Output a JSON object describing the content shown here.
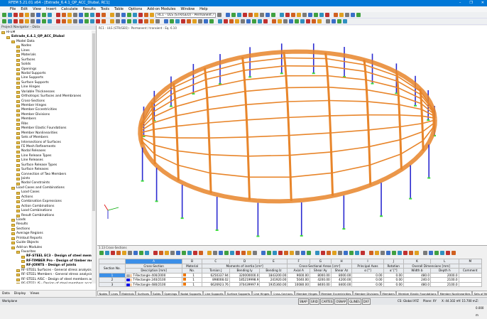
{
  "window": {
    "title": "RFEM 5.21.01 x64 - [Estrade_6.4.1_QP_ACC_Dlubal, RC1]",
    "controls": [
      "–",
      "❐",
      "✕"
    ]
  },
  "menu": [
    "File",
    "Edit",
    "View",
    "Insert",
    "Calculate",
    "Results",
    "Tools",
    "Table",
    "Options",
    "Add-on Modules",
    "Window",
    "Help"
  ],
  "toolbar": {
    "load_combo": "RC1 - ULS (STR/GEO) - Permanent / tran"
  },
  "navigator": {
    "title": "Project Navigator - Data",
    "tabs": [
      "Data",
      "Display",
      "Views"
    ],
    "items": [
      {
        "t": "RFEM",
        "l": 0
      },
      {
        "t": "Estrade_6.4.1_QP_ACC_Dlubal",
        "l": 1,
        "b": true
      },
      {
        "t": "Model Data",
        "l": 2
      },
      {
        "t": "Nodes",
        "l": 3
      },
      {
        "t": "Lines",
        "l": 3
      },
      {
        "t": "Materials",
        "l": 3
      },
      {
        "t": "Surfaces",
        "l": 3
      },
      {
        "t": "Solids",
        "l": 3
      },
      {
        "t": "Openings",
        "l": 3
      },
      {
        "t": "Nodal Supports",
        "l": 3
      },
      {
        "t": "Line Supports",
        "l": 3
      },
      {
        "t": "Surface Supports",
        "l": 3
      },
      {
        "t": "Line Hinges",
        "l": 3
      },
      {
        "t": "Variable Thicknesses",
        "l": 3
      },
      {
        "t": "Orthotropic Surfaces and Membranes",
        "l": 3
      },
      {
        "t": "Cross-Sections",
        "l": 3
      },
      {
        "t": "Member Hinges",
        "l": 3
      },
      {
        "t": "Member Eccentricities",
        "l": 3
      },
      {
        "t": "Member Divisions",
        "l": 3
      },
      {
        "t": "Members",
        "l": 3
      },
      {
        "t": "Ribs",
        "l": 3
      },
      {
        "t": "Member Elastic Foundations",
        "l": 3
      },
      {
        "t": "Member Nonlinearities",
        "l": 3
      },
      {
        "t": "Sets of Members",
        "l": 3
      },
      {
        "t": "Intersections of Surfaces",
        "l": 3
      },
      {
        "t": "FE Mesh Refinements",
        "l": 3
      },
      {
        "t": "Nodal Releases",
        "l": 3
      },
      {
        "t": "Line Release Types",
        "l": 3
      },
      {
        "t": "Line Releases",
        "l": 3
      },
      {
        "t": "Surface Release Types",
        "l": 3
      },
      {
        "t": "Surface Releases",
        "l": 3
      },
      {
        "t": "Connection of Two Members",
        "l": 3
      },
      {
        "t": "Joints",
        "l": 3
      },
      {
        "t": "Nodal Constraints",
        "l": 3
      },
      {
        "t": "Load Cases and Combinations",
        "l": 2
      },
      {
        "t": "Load Cases",
        "l": 3
      },
      {
        "t": "Actions",
        "l": 3
      },
      {
        "t": "Combination Expressions",
        "l": 3
      },
      {
        "t": "Action Combinations",
        "l": 3
      },
      {
        "t": "Load Combinations",
        "l": 3
      },
      {
        "t": "Result Combinations",
        "l": 3
      },
      {
        "t": "Loads",
        "l": 2
      },
      {
        "t": "Results",
        "l": 2
      },
      {
        "t": "Sections",
        "l": 2
      },
      {
        "t": "Average Regions",
        "l": 2
      },
      {
        "t": "Printout Reports",
        "l": 2
      },
      {
        "t": "Guide Objects",
        "l": 2
      },
      {
        "t": "Add-on Modules",
        "l": 2
      },
      {
        "t": "Favorites",
        "l": 3
      },
      {
        "t": "RF-STEEL EC3 - Design of steel members according",
        "l": 4,
        "b": true
      },
      {
        "t": "RF-TIMBER Pro - Design of timber members",
        "l": 4,
        "b": true
      },
      {
        "t": "RF-JOINTS - Design of joints",
        "l": 4,
        "b": true
      },
      {
        "t": "RF-STEEL Surfaces - General stress analysis of steel s",
        "l": 3
      },
      {
        "t": "RF-STEEL Members - General stress analysis of steel",
        "l": 3
      },
      {
        "t": "RF-STEEL AISC - Design of steel members according",
        "l": 3
      },
      {
        "t": "RF-STEEL IS - Design of steel members according to",
        "l": 3
      }
    ]
  },
  "view": {
    "label": "RC1 : ULS (STR/GEO) - Permanent / transient - Eq. 6.10",
    "colors": {
      "timber": "#e8852a",
      "column": "#2b2bd0",
      "support": "#3ddc3d"
    }
  },
  "table": {
    "title": "1.13 Cross-Sections",
    "letters": [
      "A",
      "B",
      "C",
      "D",
      "E",
      "F",
      "G",
      "H",
      "I",
      "J",
      "K",
      "L",
      "M"
    ],
    "groups": [
      "Section No.",
      "Cross-Section",
      "Material",
      "Moments of inertia [cm⁴]",
      "Cross-Sectional Areas [cm²]",
      "Principal Axes",
      "Rotation",
      "Overall Dimensions [mm]"
    ],
    "headers": [
      "Description [mm]",
      "No.",
      "Torsion J",
      "Bending Iy",
      "Bending Iz",
      "Axial A",
      "Shear Ay",
      "Shear Az",
      "α [°]",
      "α' [°]",
      "Width b",
      "Depth h",
      "Comment"
    ],
    "rows": [
      [
        "1",
        "T-Rectangle 400/2000",
        "1",
        "6250337.94",
        "320000000.0",
        "1843200.00",
        "9600.00",
        "8000.00",
        "8000.00",
        "0.00",
        "0.00",
        "480.0",
        "2000.0",
        ""
      ],
      [
        "2",
        "T-Rectangle 240/2100",
        "1",
        "898008.02",
        "185219998.9",
        "241920.00",
        "5040.00",
        "4200.00",
        "4200.00",
        "0.00",
        "0.00",
        "240.0",
        "2100.0",
        ""
      ],
      [
        "3",
        "T-Rectangle 480/2100",
        "1",
        "6626923.76",
        "370439997.9",
        "1935360.00",
        "10080.00",
        "8400.00",
        "8400.00",
        "0.00",
        "0.00",
        "480.0",
        "2100.0",
        ""
      ]
    ],
    "tabs": [
      "Nodes",
      "Lines",
      "Materials",
      "Surfaces",
      "Solids",
      "Openings",
      "Nodal Supports",
      "Line Supports",
      "Surface Supports",
      "Line Hinges",
      "Cross-Sections",
      "Member Hinges",
      "Member Eccentricities",
      "Member Divisions",
      "Members",
      "Member Elastic Foundations",
      "Member Nonlinearities",
      "Sets of Members",
      "Intersections"
    ],
    "active_tab": "Cross-Sections"
  },
  "status": {
    "left": "Workplane",
    "toggles": [
      "SNAP",
      "GRID",
      "CARTES",
      "OSNAP",
      "GLINES",
      "DXF"
    ],
    "cs": "CS: Global XYZ",
    "plane": "Plane: XY",
    "x": "X: 44.102 m",
    "y": "Y: 15.700 m",
    "z": "Z: 0.000 m"
  }
}
